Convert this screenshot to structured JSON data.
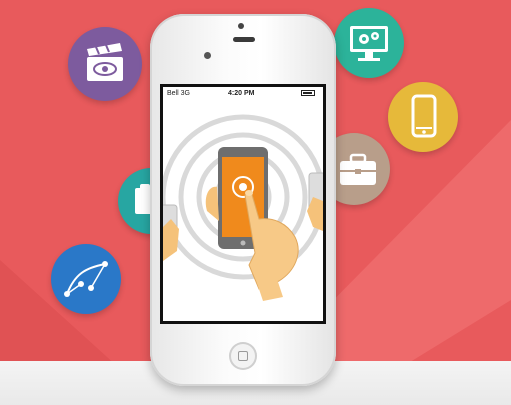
{
  "scene": {
    "background_color": "#e85a5c",
    "floor_color": "#f0f0f0"
  },
  "phone": {
    "status_bar": {
      "carrier": "Bell 3G",
      "time": "4:20 PM"
    },
    "screen_art": "hand-tapping-phone-with-signal-rings"
  },
  "icons": [
    {
      "name": "film-eye-icon",
      "color": "#7d5b9e"
    },
    {
      "name": "monitor-gears-icon",
      "color": "#2cb39a"
    },
    {
      "name": "smartphone-icon",
      "color": "#e6b93a"
    },
    {
      "name": "briefcase-icon",
      "color": "#b89e8a"
    },
    {
      "name": "clipboard-icon",
      "color": "#27a6a2"
    },
    {
      "name": "bezier-pen-icon",
      "color": "#2a78c8"
    }
  ]
}
